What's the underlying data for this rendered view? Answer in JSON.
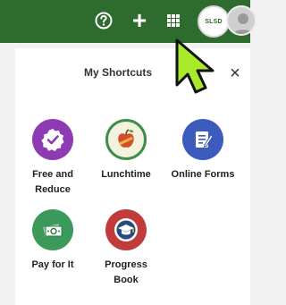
{
  "header": {
    "icons": [
      "help-icon",
      "plus-icon",
      "grid-icon"
    ],
    "logo_text": "SLSD",
    "bar_color": "#2e6b2e"
  },
  "shortcuts": {
    "title": "My Shortcuts",
    "close_label": "×",
    "apps": [
      {
        "label": "Free and\nReduce",
        "icon": "check-icon",
        "color": "#8e3bb3"
      },
      {
        "label": "Lunchtime",
        "icon": "apple-icon",
        "color": "#f0f0d8"
      },
      {
        "label": "Online Forms",
        "icon": "form-icon",
        "color": "#3d5bbd"
      },
      {
        "label": "Pay for It",
        "icon": "money-icon",
        "color": "#3b9a5a"
      },
      {
        "label": "Progress\nBook",
        "icon": "graduation-cap-icon",
        "color": "#c23b3b"
      }
    ]
  }
}
